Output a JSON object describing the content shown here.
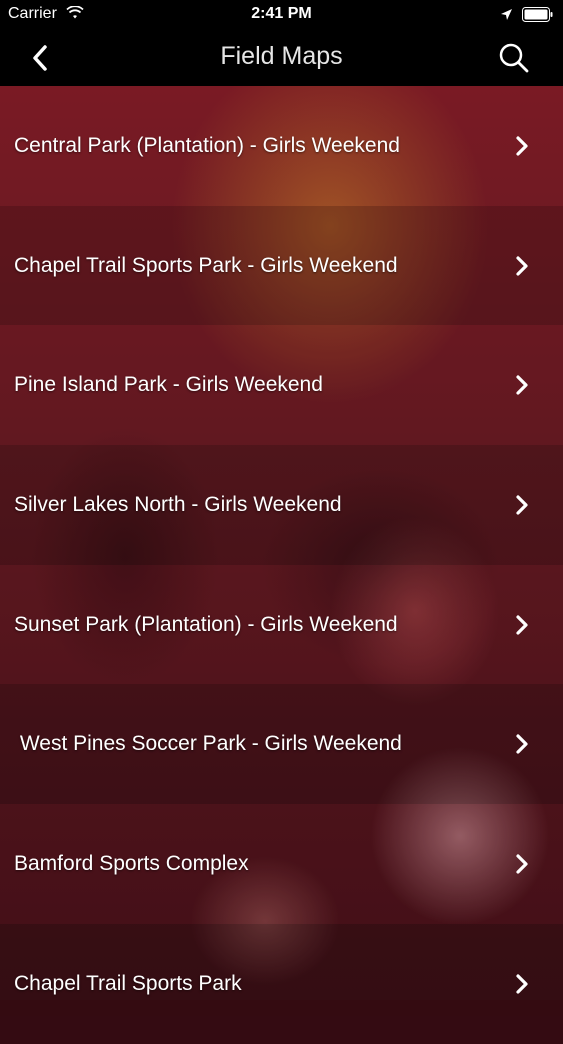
{
  "status": {
    "carrier": "Carrier",
    "time": "2:41 PM"
  },
  "nav": {
    "title": "Field Maps",
    "back_icon": "chevron-left-icon",
    "search_icon": "search-icon"
  },
  "items": [
    {
      "label": "Central Park (Plantation) - Girls Weekend"
    },
    {
      "label": "Chapel Trail Sports Park - Girls Weekend"
    },
    {
      "label": "Pine Island Park - Girls Weekend"
    },
    {
      "label": "Silver Lakes North - Girls Weekend"
    },
    {
      "label": "Sunset Park (Plantation) - Girls Weekend"
    },
    {
      "label": " West Pines Soccer Park - Girls Weekend"
    },
    {
      "label": "Bamford Sports Complex"
    },
    {
      "label": "Chapel Trail Sports Park"
    }
  ],
  "colors": {
    "bar": "#000000",
    "overlay": "#7a1a24",
    "text": "#ffffff"
  }
}
